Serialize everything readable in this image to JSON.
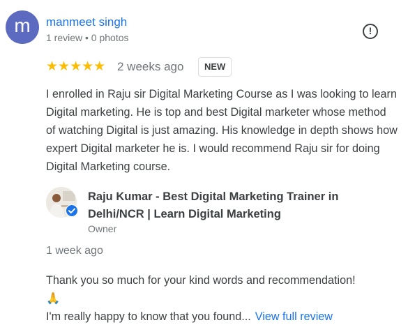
{
  "reviewer": {
    "avatar_letter": "m",
    "avatar_color": "#5c6bc0",
    "name": "manmeet singh",
    "meta": "1 review • 0 photos"
  },
  "review": {
    "rating": 5,
    "stars": "★★★★★",
    "time": "2 weeks ago",
    "badge": "NEW",
    "text": "I enrolled in Raju sir Digital Marketing Course as I was looking to learn Digital marketing. He is top and best Digital marketer whose method of watching Digital is just amazing. His knowledge in depth shows how expert Digital marketer he is. I would recommend Raju sir for doing Digital Marketing course."
  },
  "owner": {
    "name": "Raju Kumar - Best Digital Marketing Trainer in Delhi/NCR | Learn Digital Marketing",
    "role": "Owner",
    "verified_icon": "verified-check-icon"
  },
  "reply": {
    "time": "1 week ago",
    "line1": "Thank you so much for your kind words and recommendation!",
    "emoji": "🙏",
    "line2": "I'm really happy to know that you found...",
    "view_full": "View full review"
  },
  "icons": {
    "flag": "report-flag-icon"
  },
  "colors": {
    "link": "#1a73e8",
    "star": "#fbbc04",
    "text": "#3c4043",
    "muted": "#70757a"
  }
}
